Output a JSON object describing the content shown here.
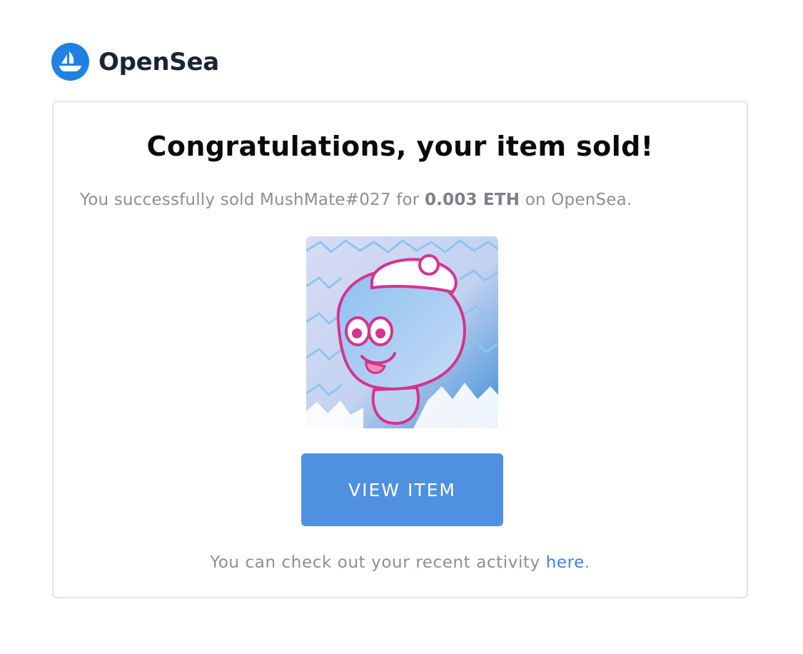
{
  "brand": {
    "name": "OpenSea",
    "logo_icon": "opensea-boat-icon",
    "logo_color": "#2081e2"
  },
  "email": {
    "title": "Congratulations, your item sold!",
    "message_prefix": "You successfully sold MushMate#027 for ",
    "price": "0.003 ETH",
    "message_suffix": " on OpenSea.",
    "item_image_icon": "mushroom-character-nft-image",
    "button_label": "VIEW ITEM",
    "button_color": "#4f90e1",
    "footer_prefix": "You can check out your recent activity ",
    "footer_link": "here",
    "footer_suffix": ".",
    "link_color": "#3d86db"
  }
}
